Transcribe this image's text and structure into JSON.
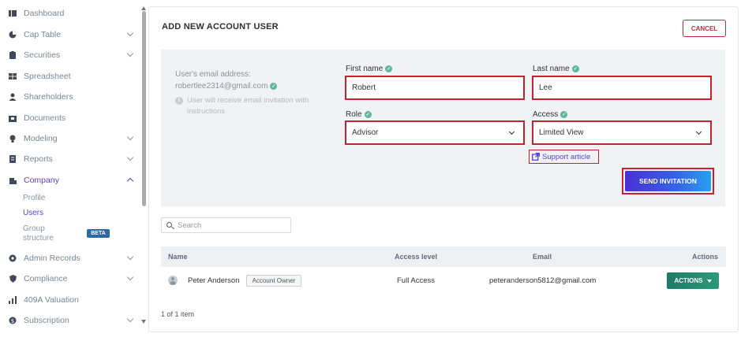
{
  "sidebar": {
    "items": [
      {
        "label": "Dashboard",
        "icon": "dashboard-icon"
      },
      {
        "label": "Cap Table",
        "icon": "pie-chart-icon"
      },
      {
        "label": "Securities",
        "icon": "clipboard-icon"
      },
      {
        "label": "Spreadsheet",
        "icon": "grid-icon"
      },
      {
        "label": "Shareholders",
        "icon": "person-icon"
      },
      {
        "label": "Documents",
        "icon": "folder-icon"
      },
      {
        "label": "Modeling",
        "icon": "lightbulb-icon"
      },
      {
        "label": "Reports",
        "icon": "report-icon"
      },
      {
        "label": "Company",
        "icon": "building-icon"
      },
      {
        "label": "Admin Records",
        "icon": "gear-icon"
      },
      {
        "label": "Compliance",
        "icon": "shield-icon"
      },
      {
        "label": "409A Valuation",
        "icon": "chart-icon"
      },
      {
        "label": "Subscription",
        "icon": "dollar-icon"
      }
    ],
    "company_sub": {
      "profile": "Profile",
      "users": "Users",
      "group_structure_line1": "Group",
      "group_structure_line2": "structure",
      "beta": "BETA"
    }
  },
  "card": {
    "title": "ADD NEW ACCOUNT USER",
    "cancel": "CANCEL"
  },
  "form": {
    "email_label": "User's email address:",
    "email_value": "robertlee2314@gmail.com",
    "hint": "User will receive email invitation with instructions",
    "first_name_label": "First name",
    "first_name_value": "Robert",
    "last_name_label": "Last name",
    "last_name_value": "Lee",
    "role_label": "Role",
    "role_value": "Advisor",
    "access_label": "Access",
    "access_value": "Limited View",
    "support_link": "Support article",
    "send": "SEND INVITATION"
  },
  "search": {
    "placeholder": "Search"
  },
  "table": {
    "headers": {
      "name": "Name",
      "access": "Access level",
      "email": "Email",
      "actions": "Actions"
    },
    "rows": [
      {
        "name": "Peter Anderson",
        "badge": "Account Owner",
        "access": "Full Access",
        "email": "peteranderson5812@gmail.com",
        "action": "ACTIONS"
      }
    ],
    "footer": "1 of 1 item"
  },
  "colors": {
    "accent": "#5b3fd6",
    "highlight": "#c0242e",
    "success": "#5cb89b",
    "action_green": "#1f7a64"
  }
}
